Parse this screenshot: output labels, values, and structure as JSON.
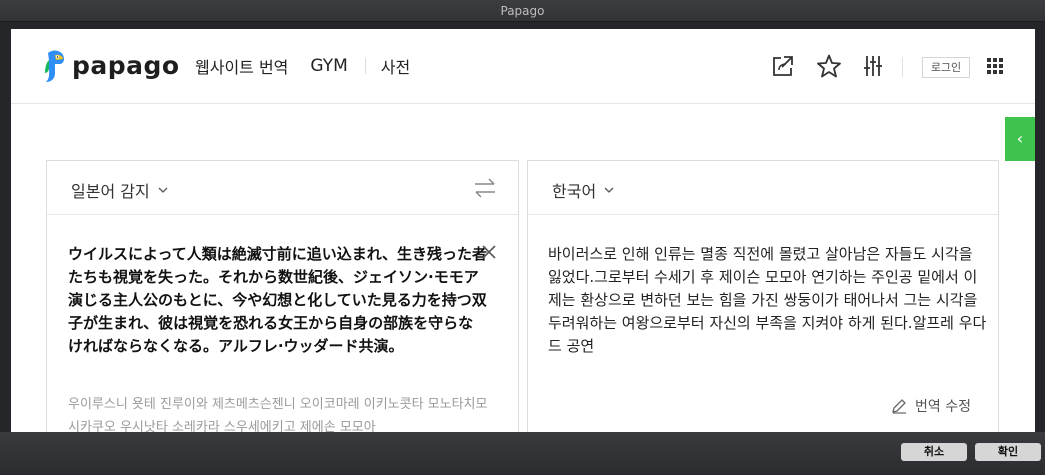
{
  "window_title": "Papago",
  "header": {
    "logo_text": "papago",
    "nav": [
      "웹사이트 번역",
      "GYM",
      "사전"
    ],
    "icons": [
      "share-icon",
      "star-icon",
      "settings-sliders-icon",
      "apps-grid-icon"
    ],
    "login_label": "로그인"
  },
  "side_toggle": "‹",
  "source": {
    "language": "일본어 감지",
    "text": "ウイルスによって人類は絶滅寸前に追い込まれ、生き残った者たちも視覚を失った。それから数世紀後、ジェイソン·モモア演じる主人公のもとに、今や幻想と化していた見る力を持つ双子が生まれ、彼は視覚を恐れる女王から自身の部族を守らなければならなくなる。アルフレ·ウッダード共演。",
    "pronunciation": "우이루스니 욧테 진루이와 제츠메츠슨젠니 오이코마레 이키노콧타 모노타치모 시카쿠오 우시낫타 소레카라 스우세에키고 제에손 모모아"
  },
  "target": {
    "language": "한국어",
    "text": "바이러스로 인해 인류는 멸종 직전에 몰렸고 살아남은 자들도 시각을 잃었다.그로부터 수세기 후 제이슨 모모아 연기하는 주인공 밑에서 이제는 환상으로 변하던 보는 힘을 가진 쌍둥이가 태어나서 그는 시각을 두려워하는 여왕으로부터 자신의 부족을 지켜야 하게 된다.알프레 우다드 공연",
    "edit_label": "번역 수정"
  },
  "footer": {
    "cancel_label": "취소",
    "confirm_label": "확인"
  },
  "colors": {
    "accent_green": "#3ec34f",
    "logo_blue": "#2f8ef5",
    "logo_yellow": "#f2c21b"
  }
}
